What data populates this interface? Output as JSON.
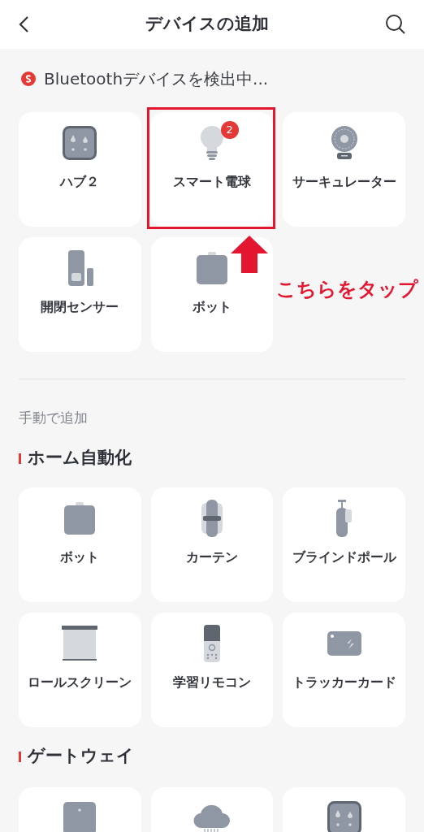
{
  "header": {
    "title": "デバイスの追加"
  },
  "detected": {
    "title": "Bluetoothデバイスを検出中...",
    "devices": [
      {
        "kind": "hub",
        "label": "ハブ２",
        "highlighted": false
      },
      {
        "kind": "bulb",
        "label": "スマート電球",
        "badge": "2",
        "highlighted": true
      },
      {
        "kind": "fan",
        "label": "サーキュレーター",
        "highlighted": false
      },
      {
        "kind": "sensor",
        "label": "開閉センサー",
        "highlighted": false
      },
      {
        "kind": "bot",
        "label": "ボット",
        "highlighted": false
      }
    ]
  },
  "annotation": {
    "text": "こちらをタップ"
  },
  "manual": {
    "title": "手動で追加",
    "groups": [
      {
        "title": "ホーム自動化",
        "devices": [
          {
            "kind": "bot",
            "label": "ボット"
          },
          {
            "kind": "curtain",
            "label": "カーテン"
          },
          {
            "kind": "pole",
            "label": "ブラインドポール"
          },
          {
            "kind": "screen",
            "label": "ロールスクリーン"
          },
          {
            "kind": "remote",
            "label": "学習リモコン"
          },
          {
            "kind": "card",
            "label": "トラッカーカード"
          }
        ]
      },
      {
        "title": "ゲートウェイ",
        "devices": [
          {
            "kind": "gateway"
          },
          {
            "kind": "cloud"
          },
          {
            "kind": "hub"
          }
        ]
      }
    ]
  }
}
